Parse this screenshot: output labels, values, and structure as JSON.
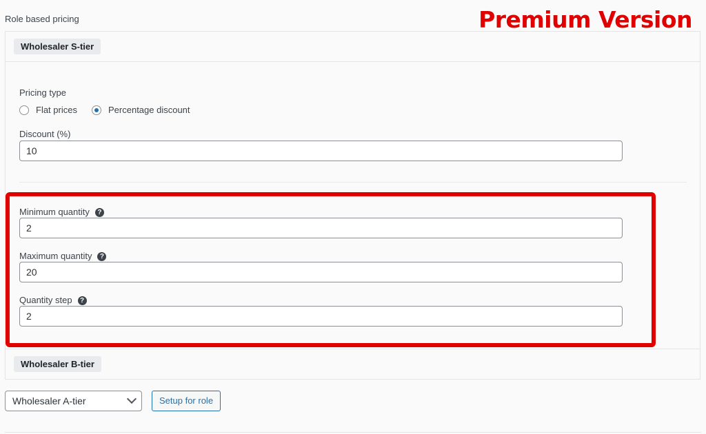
{
  "section_label": "Role based pricing",
  "premium_badge": "Premium Version",
  "roles": [
    {
      "tag": "Wholesaler S-tier"
    },
    {
      "tag": "Wholesaler B-tier"
    }
  ],
  "pricing": {
    "label": "Pricing type",
    "options": [
      {
        "label": "Flat prices",
        "checked": false
      },
      {
        "label": "Percentage discount",
        "checked": true
      }
    ]
  },
  "discount": {
    "label": "Discount (%)",
    "value": "10"
  },
  "min_qty": {
    "label": "Minimum quantity",
    "value": "2"
  },
  "max_qty": {
    "label": "Maximum quantity",
    "value": "20"
  },
  "qty_step": {
    "label": "Quantity step",
    "value": "2"
  },
  "role_select": {
    "value": "Wholesaler A-tier"
  },
  "setup_button": "Setup for role",
  "colors": {
    "accent": "#2271b1",
    "highlight": "#e00000"
  }
}
